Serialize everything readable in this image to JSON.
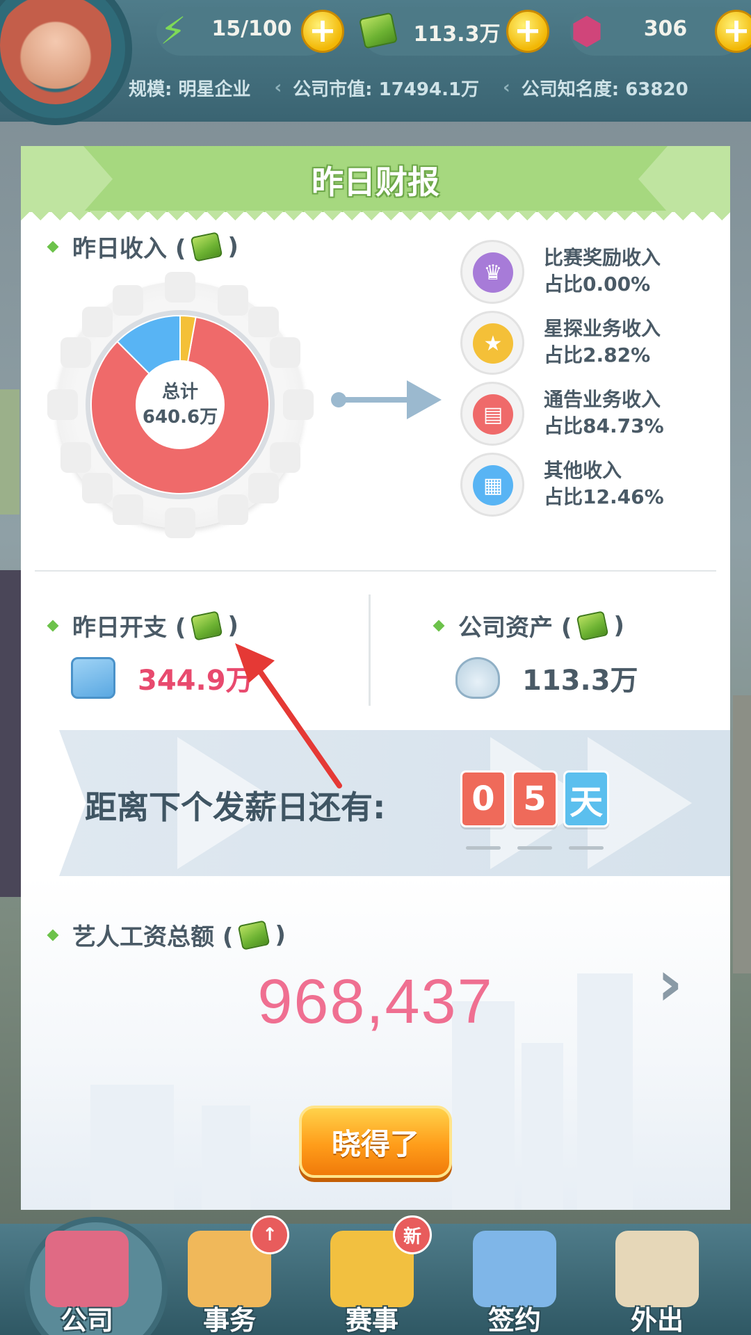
{
  "hud": {
    "energy": "15/100",
    "cash": "113.3万",
    "gems": "306",
    "scale_label": "规模: 明星企业",
    "market_value_label": "公司市值: 17494.1万",
    "fame_label": "公司知名度: 63820",
    "plus_symbol": "+"
  },
  "dialog": {
    "title": "昨日财报",
    "income": {
      "label": "昨日收入 (",
      "label_close": ")",
      "total_caption": "总计",
      "total_value": "640.6万",
      "breakdown": [
        {
          "name": "比赛奖励收入",
          "pct_label": "占比0.00%",
          "pct": 0.0,
          "color": "#a77bd8",
          "icon": "trophy-icon",
          "glyph": "♛"
        },
        {
          "name": "星探业务收入",
          "pct_label": "占比2.82%",
          "pct": 2.82,
          "color": "#f4c038",
          "icon": "magnifier-star-icon",
          "glyph": "★"
        },
        {
          "name": "通告业务收入",
          "pct_label": "占比84.73%",
          "pct": 84.73,
          "color": "#ef6a6a",
          "icon": "clapperboard-icon",
          "glyph": "▤"
        },
        {
          "name": "其他收入",
          "pct_label": "占比12.46%",
          "pct": 12.46,
          "color": "#58b4f4",
          "icon": "grid-icon",
          "glyph": "▦"
        }
      ]
    },
    "expense": {
      "label": "昨日开支 (",
      "label_close": ")",
      "value": "344.9万"
    },
    "assets": {
      "label": "公司资产 (",
      "label_close": ")",
      "value": "113.3万"
    },
    "payday": {
      "text": "距离下个发薪日还有:",
      "digit1": "0",
      "digit2": "5",
      "unit": "天"
    },
    "salary": {
      "label": "艺人工资总额 (",
      "label_close": ")",
      "value": "968,437",
      "chevron": "›"
    },
    "ok_button": "晓得了"
  },
  "nav": {
    "items": [
      {
        "label": "公司",
        "active": true
      },
      {
        "label": "事务",
        "badge": "↑"
      },
      {
        "label": "赛事",
        "badge": "新"
      },
      {
        "label": "签约"
      },
      {
        "label": "外出"
      }
    ]
  },
  "colors": {
    "accent_green": "#6cc24a",
    "expense_red": "#e84a6e",
    "salary_pink": "#ef6f91",
    "button_orange": "#ff9d1a"
  }
}
